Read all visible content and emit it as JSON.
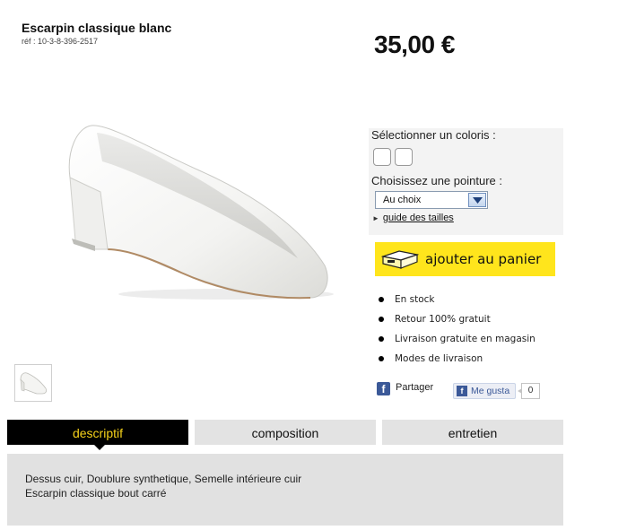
{
  "product": {
    "title": "Escarpin classique blanc",
    "ref": "réf : 10-3-8-396-2517",
    "price": "35,00 €",
    "color": "white",
    "thumbnail_alt": "shoe-thumbnail"
  },
  "options": {
    "color_label": "Sélectionner un coloris :",
    "size_label": "Choisissez une pointure :",
    "size_selected": "Au choix",
    "size_guide_label": "guide des tailles"
  },
  "cart": {
    "button_label": "ajouter au panier",
    "button_color": "#ffe51c"
  },
  "features": [
    "En stock",
    "Retour 100% gratuit",
    "Livraison gratuite en magasin",
    "Modes de livraison"
  ],
  "social": {
    "share_label": "Partager",
    "like_label": "Me gusta",
    "like_count": "0"
  },
  "tabs": [
    {
      "label": "descriptif",
      "active": true
    },
    {
      "label": "composition",
      "active": false
    },
    {
      "label": "entretien",
      "active": false
    }
  ],
  "description": {
    "line1": "Dessus cuir, Doublure synthetique, Semelle intérieure cuir",
    "line2": "Escarpin classique bout carré"
  },
  "colors": {
    "accent_yellow": "#ffe51c",
    "tab_active_bg": "#000000",
    "tab_active_text": "#f6d21a",
    "facebook_blue": "#3b5998"
  }
}
